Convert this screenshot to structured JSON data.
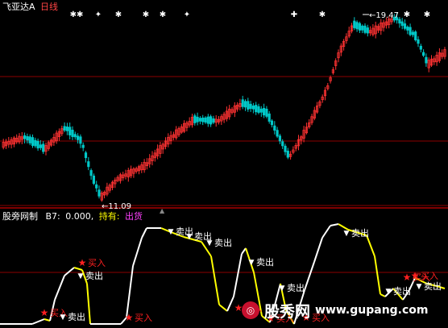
{
  "colors": {
    "background": "#000000",
    "up": "#ff3232",
    "down": "#00c8c8",
    "grid": "#8b0000",
    "title": "#ffffff",
    "period": "#ff4444",
    "buy": "#ff2020",
    "sell": "#ffffff",
    "line_up": "#ffffff",
    "line_down": "#ffff00",
    "value": "#ffffff",
    "hold": "#ffff00",
    "hold_value": "#ff40ff"
  },
  "header": {
    "stock_name": "飞亚达A",
    "period": "日线"
  },
  "price_panel": {
    "high_label": "19.47",
    "low_label": "11.09",
    "signal_marks": [
      "✱✱",
      "✦",
      "✱",
      "✱",
      "✱",
      "✦",
      "✚",
      "✱",
      "✱",
      "✱"
    ]
  },
  "indicator_panel": {
    "name": "股旁网制",
    "b7_label": "B7:",
    "b7_value": "0.000,",
    "hold_label": "持有:",
    "hold_value": "出货"
  },
  "signals": {
    "buy_text": "买入",
    "sell_text": "卖出",
    "buy_icon": "star-icon",
    "sell_icon": "triangle-down-icon"
  },
  "watermark": {
    "name": "股秀网",
    "url": "www.gupang.com",
    "icon": "globe-icon"
  }
}
